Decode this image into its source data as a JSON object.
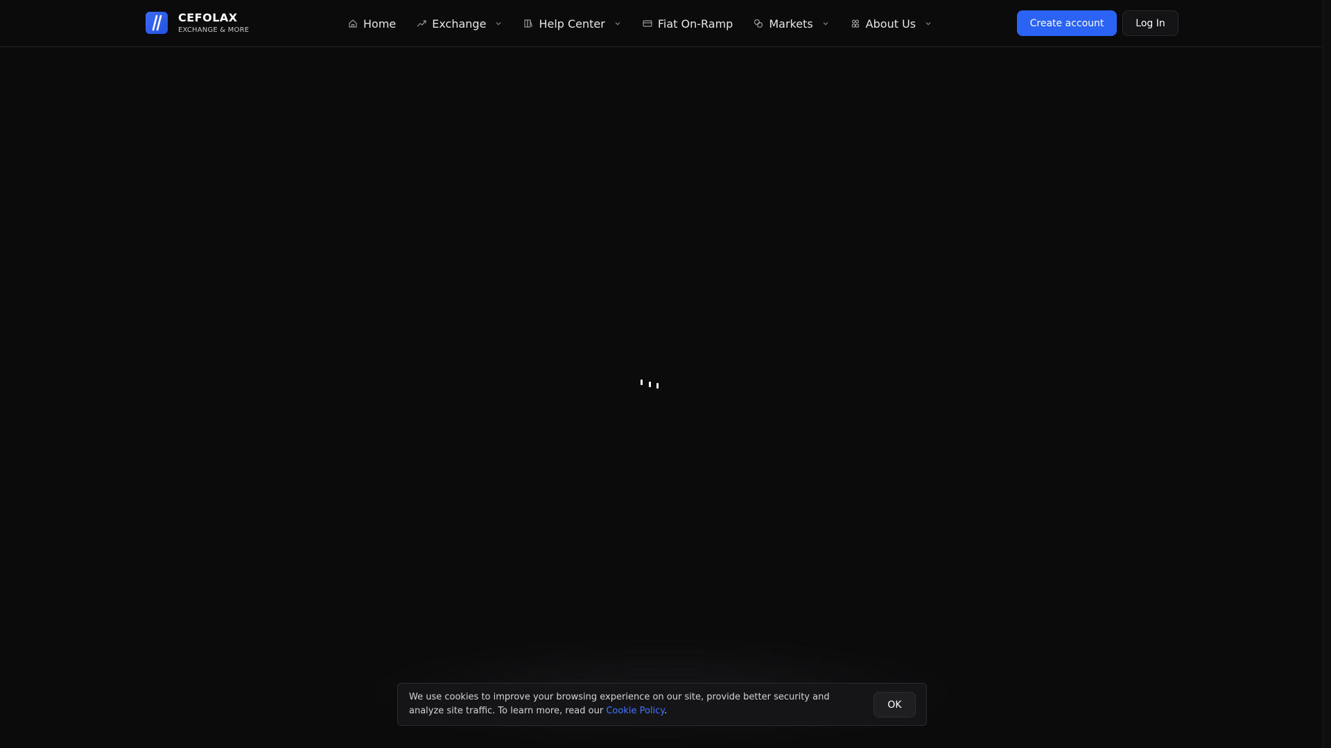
{
  "brand": {
    "name": "CEFOLAX",
    "tagline": "EXCHANGE & MORE",
    "accent_color": "#2b63f5"
  },
  "nav": {
    "items": [
      {
        "label": "Home",
        "icon": "home-icon",
        "has_dropdown": false
      },
      {
        "label": "Exchange",
        "icon": "trend-up-icon",
        "has_dropdown": true
      },
      {
        "label": "Help Center",
        "icon": "book-icon",
        "has_dropdown": true
      },
      {
        "label": "Fiat On-Ramp",
        "icon": "card-icon",
        "has_dropdown": false
      },
      {
        "label": "Markets",
        "icon": "coins-icon",
        "has_dropdown": true
      },
      {
        "label": "About Us",
        "icon": "people-icon",
        "has_dropdown": true
      }
    ]
  },
  "auth": {
    "create_label": "Create account",
    "login_label": "Log In"
  },
  "cookie": {
    "text_before_link": "We use cookies to improve your browsing experience on our site, provide better security and analyze site traffic. To learn more, read our ",
    "link_label": "Cookie Policy",
    "text_after_link": ".",
    "ok_label": "OK"
  }
}
